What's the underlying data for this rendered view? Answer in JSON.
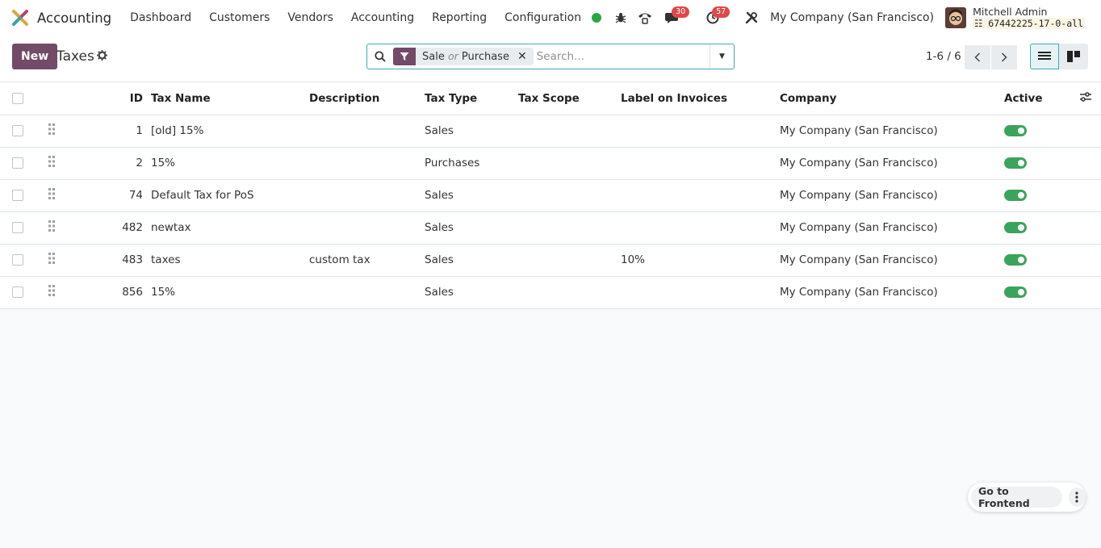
{
  "app": {
    "name": "Accounting"
  },
  "menu": [
    "Dashboard",
    "Customers",
    "Vendors",
    "Accounting",
    "Reporting",
    "Configuration"
  ],
  "systray": {
    "status_color": "#28a745",
    "messages_count": "30",
    "activities_count": "57",
    "company": "My Company (San Francisco)",
    "user_name": "Mitchell Admin",
    "database": "67442225-17-0-all"
  },
  "control": {
    "new_label": "New",
    "title": "Taxes",
    "facet_first": "Sale",
    "facet_or": "or",
    "facet_second": "Purchase",
    "search_placeholder": "Search...",
    "pager": "1-6 / 6"
  },
  "table": {
    "columns": [
      "ID",
      "Tax Name",
      "Description",
      "Tax Type",
      "Tax Scope",
      "Label on Invoices",
      "Company",
      "Active"
    ],
    "rows": [
      {
        "id": "1",
        "name": "[old] 15%",
        "description": "",
        "type": "Sales",
        "scope": "",
        "label": "",
        "company": "My Company (San Francisco)",
        "active": true
      },
      {
        "id": "2",
        "name": "15%",
        "description": "",
        "type": "Purchases",
        "scope": "",
        "label": "",
        "company": "My Company (San Francisco)",
        "active": true
      },
      {
        "id": "74",
        "name": "Default Tax for PoS",
        "description": "",
        "type": "Sales",
        "scope": "",
        "label": "",
        "company": "My Company (San Francisco)",
        "active": true
      },
      {
        "id": "482",
        "name": "newtax",
        "description": "",
        "type": "Sales",
        "scope": "",
        "label": "",
        "company": "My Company (San Francisco)",
        "active": true
      },
      {
        "id": "483",
        "name": "taxes",
        "description": "custom tax",
        "type": "Sales",
        "scope": "",
        "label": "10%",
        "company": "My Company (San Francisco)",
        "active": true
      },
      {
        "id": "856",
        "name": "15%",
        "description": "",
        "type": "Sales",
        "scope": "",
        "label": "",
        "company": "My Company (San Francisco)",
        "active": true
      }
    ]
  },
  "frontend": {
    "label": "Go to Frontend"
  },
  "colors": {
    "brand": "#714b67",
    "toggle_on": "#3ba45b",
    "badge": "#e04848",
    "search_border": "#3fa9b5"
  }
}
